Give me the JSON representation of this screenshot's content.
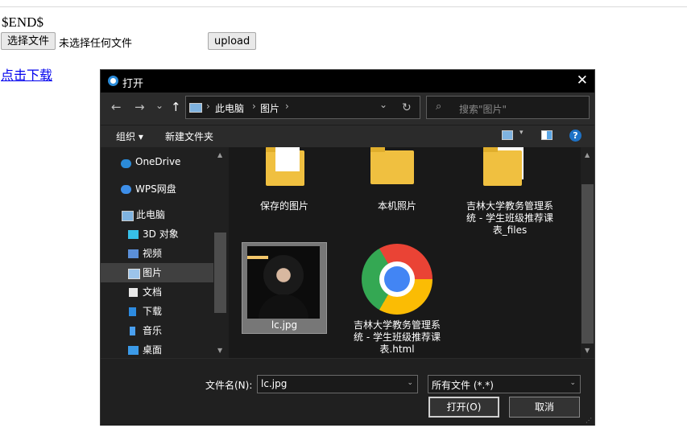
{
  "page": {
    "end_text": "$END$",
    "choose_file_label": "选择文件",
    "no_file_text": "未选择任何文件",
    "upload_label": "upload",
    "download_link": "点击下载"
  },
  "dialog": {
    "title": "打开",
    "close_glyph": "✕",
    "nav": {
      "back": "←",
      "forward": "→",
      "recent": "⌄",
      "up": "↑",
      "refresh": "↻",
      "dropdown": "⌄"
    },
    "breadcrumb": [
      "此电脑",
      "图片"
    ],
    "breadcrumb_sep": "›",
    "search_placeholder": "搜索\"图片\"",
    "search_icon": "⌕",
    "toolbar": {
      "organize": "组织 ▾",
      "new_folder": "新建文件夹",
      "view_caret": "▾",
      "help": "?"
    },
    "sidebar": [
      {
        "label": "OneDrive",
        "icon": "cloud-icon",
        "color": "#2b8bd8"
      },
      {
        "label": "WPS网盘",
        "icon": "cloud-icon",
        "color": "#3d8ee8"
      },
      {
        "label": "此电脑",
        "icon": "computer-icon",
        "color": "#7fb3e0"
      },
      {
        "label": "3D 对象",
        "icon": "cube-icon",
        "color": "#37c0e8"
      },
      {
        "label": "视频",
        "icon": "video-icon",
        "color": "#5b8fd8"
      },
      {
        "label": "图片",
        "icon": "picture-icon",
        "color": "#9cc4ea",
        "selected": true
      },
      {
        "label": "文档",
        "icon": "document-icon",
        "color": "#e8e8e8"
      },
      {
        "label": "下载",
        "icon": "download-icon",
        "color": "#2d8be0"
      },
      {
        "label": "音乐",
        "icon": "music-icon",
        "color": "#4aa0f0"
      },
      {
        "label": "桌面",
        "icon": "desktop-icon",
        "color": "#3b9ae8"
      }
    ],
    "files": [
      {
        "label": "保存的图片",
        "type": "folder"
      },
      {
        "label": "本机照片",
        "type": "folder"
      },
      {
        "label": "吉林大学教务管理系统 - 学生班级推荐课表_files",
        "type": "folder"
      },
      {
        "label": "lc.jpg",
        "type": "image",
        "selected": true
      },
      {
        "label": "吉林大学教务管理系统 - 学生班级推荐课表.html",
        "type": "chrome-html"
      }
    ],
    "filename_label": "文件名(N):",
    "filename_value": "lc.jpg",
    "filetype_value": "所有文件 (*.*)",
    "open_label": "打开(O)",
    "cancel_label": "取消",
    "dd_arrow": "⌄",
    "scroll_up": "▲",
    "scroll_down": "▼",
    "grip": "⋰"
  }
}
